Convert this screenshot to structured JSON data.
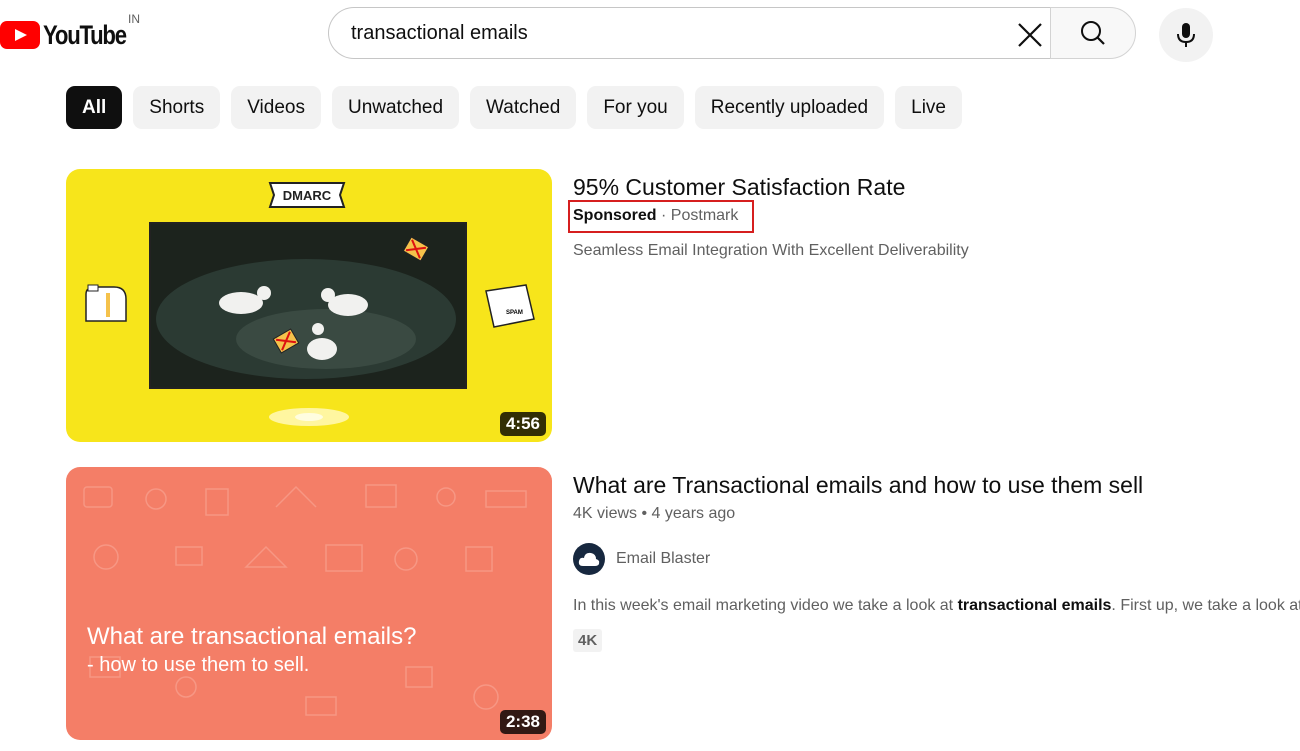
{
  "header": {
    "logo_text": "YouTube",
    "country_code": "IN",
    "search_query": "transactional emails"
  },
  "chips": [
    "All",
    "Shorts",
    "Videos",
    "Unwatched",
    "Watched",
    "For you",
    "Recently uploaded",
    "Live"
  ],
  "results": [
    {
      "title": "95% Customer Satisfaction Rate",
      "sponsored_label": "Sponsored",
      "separator": "·",
      "advertiser": "Postmark",
      "description": "Seamless Email Integration With Excellent Deliverability",
      "duration": "4:56",
      "thumb_badge": "DMARC",
      "thumb_folder_label": "SPAM"
    },
    {
      "title": "What are Transactional emails and how to use them sell",
      "views": "4K views",
      "age": "4 years ago",
      "meta_separator": "•",
      "channel": "Email Blaster",
      "description_before": "In this week's email marketing video we take a look at ",
      "description_bold": "transactional emails",
      "description_after": ". First up, we take a look at",
      "badge": "4K",
      "duration": "2:38",
      "thumb_line1": "What are transactional emails?",
      "thumb_line2": "- how to use them to sell."
    }
  ],
  "colors": {
    "brand_red": "#ff0000",
    "thumb1_bg": "#f7e51b",
    "thumb2_bg": "#f47e67",
    "highlight_box": "#d61f1f"
  },
  "icons": [
    "youtube-logo-icon",
    "clear-icon",
    "search-icon",
    "mic-icon",
    "cloud-avatar-icon"
  ]
}
